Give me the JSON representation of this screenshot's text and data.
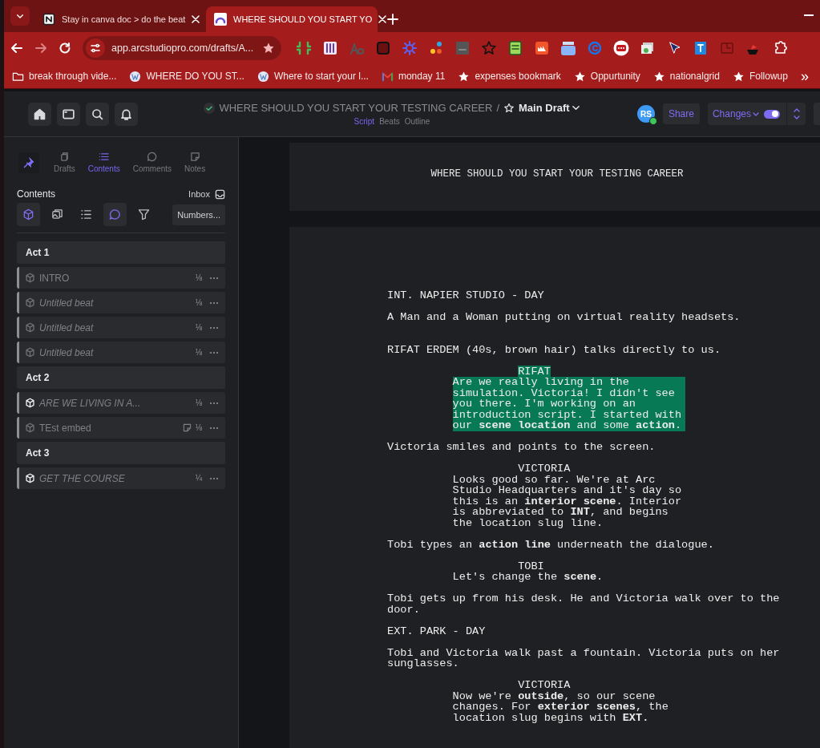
{
  "browser": {
    "tabs": [
      {
        "title": "Stay in canva doc > do the beat",
        "selected": false
      },
      {
        "title": "WHERE SHOULD YOU START YO",
        "selected": true
      }
    ],
    "address": "app.arcstudiopro.com/drafts/A...",
    "bookmarks": [
      {
        "label": "break through vide...",
        "kind": "folder"
      },
      {
        "label": "WHERE DO YOU ST...",
        "kind": "site"
      },
      {
        "label": "Where to start your l...",
        "kind": "site"
      },
      {
        "label": "monday 11",
        "kind": "mail"
      },
      {
        "label": "expenses bookmark",
        "kind": "star"
      },
      {
        "label": "Oppurtunity",
        "kind": "star"
      },
      {
        "label": "nationalgrid",
        "kind": "star"
      },
      {
        "label": "Followup",
        "kind": "star"
      }
    ],
    "more_bookmarks": "»"
  },
  "app": {
    "title": "WHERE SHOULD YOU START YOUR TESTING CAREER",
    "separator": "/",
    "draft": "Main Draft",
    "views": [
      {
        "label": "Script",
        "selected": true
      },
      {
        "label": "Beats",
        "selected": false
      },
      {
        "label": "Outline",
        "selected": false
      }
    ],
    "avatar": {
      "initials": "RS",
      "online": true
    },
    "share": "Share",
    "changes": {
      "label": "Changes",
      "on": true
    }
  },
  "sidebar": {
    "tabs": [
      {
        "label": "Drafts",
        "selected": false
      },
      {
        "label": "Contents",
        "selected": true
      },
      {
        "label": "Comments",
        "selected": false
      },
      {
        "label": "Notes",
        "selected": false
      }
    ],
    "heading": "Contents",
    "inbox": "Inbox",
    "filters": [
      {
        "on": true
      },
      {
        "on": false
      },
      {
        "on": false
      },
      {
        "on": true
      },
      {
        "on": false
      }
    ],
    "numbers": "Numbers...",
    "acts": [
      {
        "title": "Act 1",
        "children": [
          {
            "title": "INTRO",
            "italic": false,
            "icon_bright": false,
            "note": false,
            "fraction": "⅛"
          },
          {
            "title": "Untitled beat",
            "italic": true,
            "icon_bright": false,
            "note": false,
            "fraction": "⅛"
          },
          {
            "title": "Untitled beat",
            "italic": true,
            "icon_bright": false,
            "note": false,
            "fraction": "⅛"
          },
          {
            "title": "Untitled beat",
            "italic": true,
            "icon_bright": false,
            "note": false,
            "fraction": "⅛"
          }
        ]
      },
      {
        "title": "Act 2",
        "children": [
          {
            "title": "ARE WE LIVING IN A...",
            "italic": true,
            "icon_bright": true,
            "note": false,
            "fraction": "⅛"
          },
          {
            "title": "TEst embed",
            "italic": false,
            "icon_bright": false,
            "note": true,
            "fraction": "⅛"
          }
        ]
      },
      {
        "title": "Act 3",
        "children": [
          {
            "title": "GET THE COURSE",
            "italic": true,
            "icon_bright": true,
            "note": false,
            "fraction": "¼"
          }
        ]
      }
    ]
  },
  "script": {
    "title": "WHERE SHOULD YOU START YOUR TESTING CAREER",
    "elements": [
      {
        "kind": "scene",
        "text": "INT. NAPIER STUDIO - DAY",
        "highlighted": false
      },
      {
        "kind": "action",
        "text": "A Man and a Woman putting on virtual reality headsets.",
        "highlighted": false
      },
      {
        "kind": "action",
        "text": "RIFAT ERDEM (40s, brown hair) talks directly to us.",
        "highlighted": false
      },
      {
        "kind": "character",
        "text": "RIFAT",
        "highlighted": true
      },
      {
        "kind": "dialogue",
        "text": "Are we really living in the simulation. Victoria! I didn't see you there. I'm working on an introduction script. I started with our **scene location** and some **action**.",
        "highlighted": true
      },
      {
        "kind": "action",
        "text": "Victoria smiles and points to the screen.",
        "highlighted": false
      },
      {
        "kind": "character",
        "text": "VICTORIA",
        "highlighted": false
      },
      {
        "kind": "dialogue",
        "text": "Looks good so far. We're at Arc Studio Headquarters and it's day so this is an **interior scene**. Interior is abbreviated to **INT**, and begins the location slug line.",
        "highlighted": false
      },
      {
        "kind": "action",
        "text": "Tobi types an **action line** underneath the dialogue.",
        "highlighted": false
      },
      {
        "kind": "character",
        "text": "TOBI",
        "highlighted": false
      },
      {
        "kind": "dialogue",
        "text": "Let's change the **scene**.",
        "highlighted": false
      },
      {
        "kind": "action",
        "text": "Tobi gets up from his desk. He and Victoria walk over to the door.",
        "highlighted": false
      },
      {
        "kind": "scene",
        "text": "EXT. PARK - DAY",
        "highlighted": false
      },
      {
        "kind": "action",
        "text": "Tobi and Victoria walk past a fountain. Victoria puts on her sunglasses.",
        "highlighted": false
      },
      {
        "kind": "character",
        "text": "VICTORIA",
        "highlighted": false
      },
      {
        "kind": "dialogue",
        "text": "Now we're **outside**, so our scene changes. For **exterior scenes**, the location slug begins with **EXT.**",
        "highlighted": false
      }
    ]
  }
}
